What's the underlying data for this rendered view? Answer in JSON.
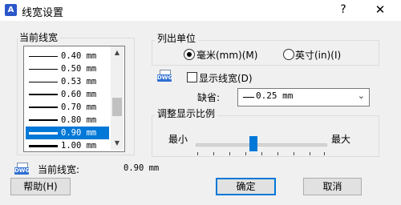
{
  "window": {
    "title": "线宽设置",
    "app_icon": "A",
    "help_glyph": "?",
    "close_glyph": "✕"
  },
  "current_lineweight_group": {
    "label": "当前线宽",
    "items": [
      {
        "text": "0.40 mm",
        "weight": 1,
        "selected": false
      },
      {
        "text": "0.50 mm",
        "weight": 1,
        "selected": false
      },
      {
        "text": "0.53 mm",
        "weight": 1,
        "selected": false
      },
      {
        "text": "0.60 mm",
        "weight": 2,
        "selected": false
      },
      {
        "text": "0.70 mm",
        "weight": 2,
        "selected": false
      },
      {
        "text": "0.80 mm",
        "weight": 2,
        "selected": false
      },
      {
        "text": "0.90 mm",
        "weight": 3,
        "selected": true
      },
      {
        "text": "1.00 mm",
        "weight": 3,
        "selected": false
      }
    ],
    "scroll_up_glyph": "▲",
    "scroll_down_glyph": "▼"
  },
  "units_group": {
    "label": "列出单位",
    "mm_label": "毫米(mm)(M)",
    "inch_label": "英寸(in)(I)",
    "selected": "mm"
  },
  "display_lineweight": {
    "label": "显示线宽(D)",
    "checked": false
  },
  "default": {
    "label": "缺省:",
    "value": "0.25 mm",
    "chevron": "⌄"
  },
  "scale_group": {
    "label": "调整显示比例",
    "min_label": "最小",
    "max_label": "最大"
  },
  "current_readout": {
    "label": "当前线宽:",
    "value": "0.90 mm"
  },
  "icons": {
    "dwg_text": "DWG"
  },
  "buttons": {
    "help": "帮助(H)",
    "ok": "确定",
    "cancel": "取消"
  },
  "colors": {
    "accent": "#0078d7",
    "selection": "#0078d7"
  }
}
